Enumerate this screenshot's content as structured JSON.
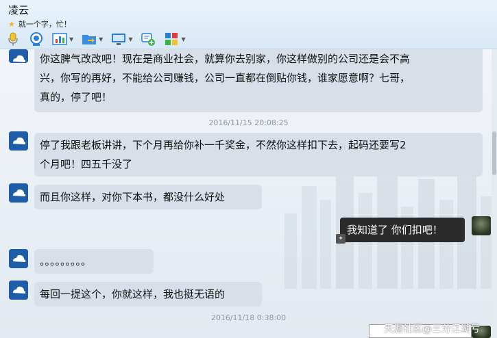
{
  "header": {
    "contact_name": "凌云",
    "status_text": "就一个字，忙！",
    "toolbar": [
      {
        "icon": "microphone-icon"
      },
      {
        "icon": "webcam-icon"
      },
      {
        "icon": "chart-icon"
      },
      {
        "icon": "folder-transfer-icon"
      },
      {
        "icon": "remote-desktop-icon"
      },
      {
        "icon": "add-message-icon"
      },
      {
        "icon": "apps-icon"
      }
    ]
  },
  "messages": [
    {
      "text_lines": [
        "你这脾气改改吧！现在是商业社会，就算你去别家，你这样做别的公司还是会不高",
        "兴，你写的再好，不能给公司赚钱，公司一直都在倒贴你钱，谁家愿意啊？七哥，",
        "真的，停了吧！"
      ]
    },
    {
      "text_lines": [
        "停了我跟老板讲讲，下个月再给你补一千奖金，不然你这样扣下去，起码还要写2",
        "个月吧！四五千没了"
      ]
    },
    {
      "text_lines": [
        "而且你这样，对你下本书，都没什么好处"
      ]
    },
    {
      "text_lines": [
        "。。。。。。。。。"
      ]
    },
    {
      "text_lines": [
        "每回一提这个，你就这样，我也挺无语的"
      ]
    }
  ],
  "timestamps": [
    "2016/11/15 20:08:25",
    "2016/11/18 0:38:00"
  ],
  "self_message": "我知道了 你们扣吧！",
  "watermark": "天涯社区@三分江湖亏",
  "colors": {
    "bubble_other": "#d8dfe8",
    "bubble_self": "#2b2b2b",
    "timestamp": "#8a96a4"
  }
}
